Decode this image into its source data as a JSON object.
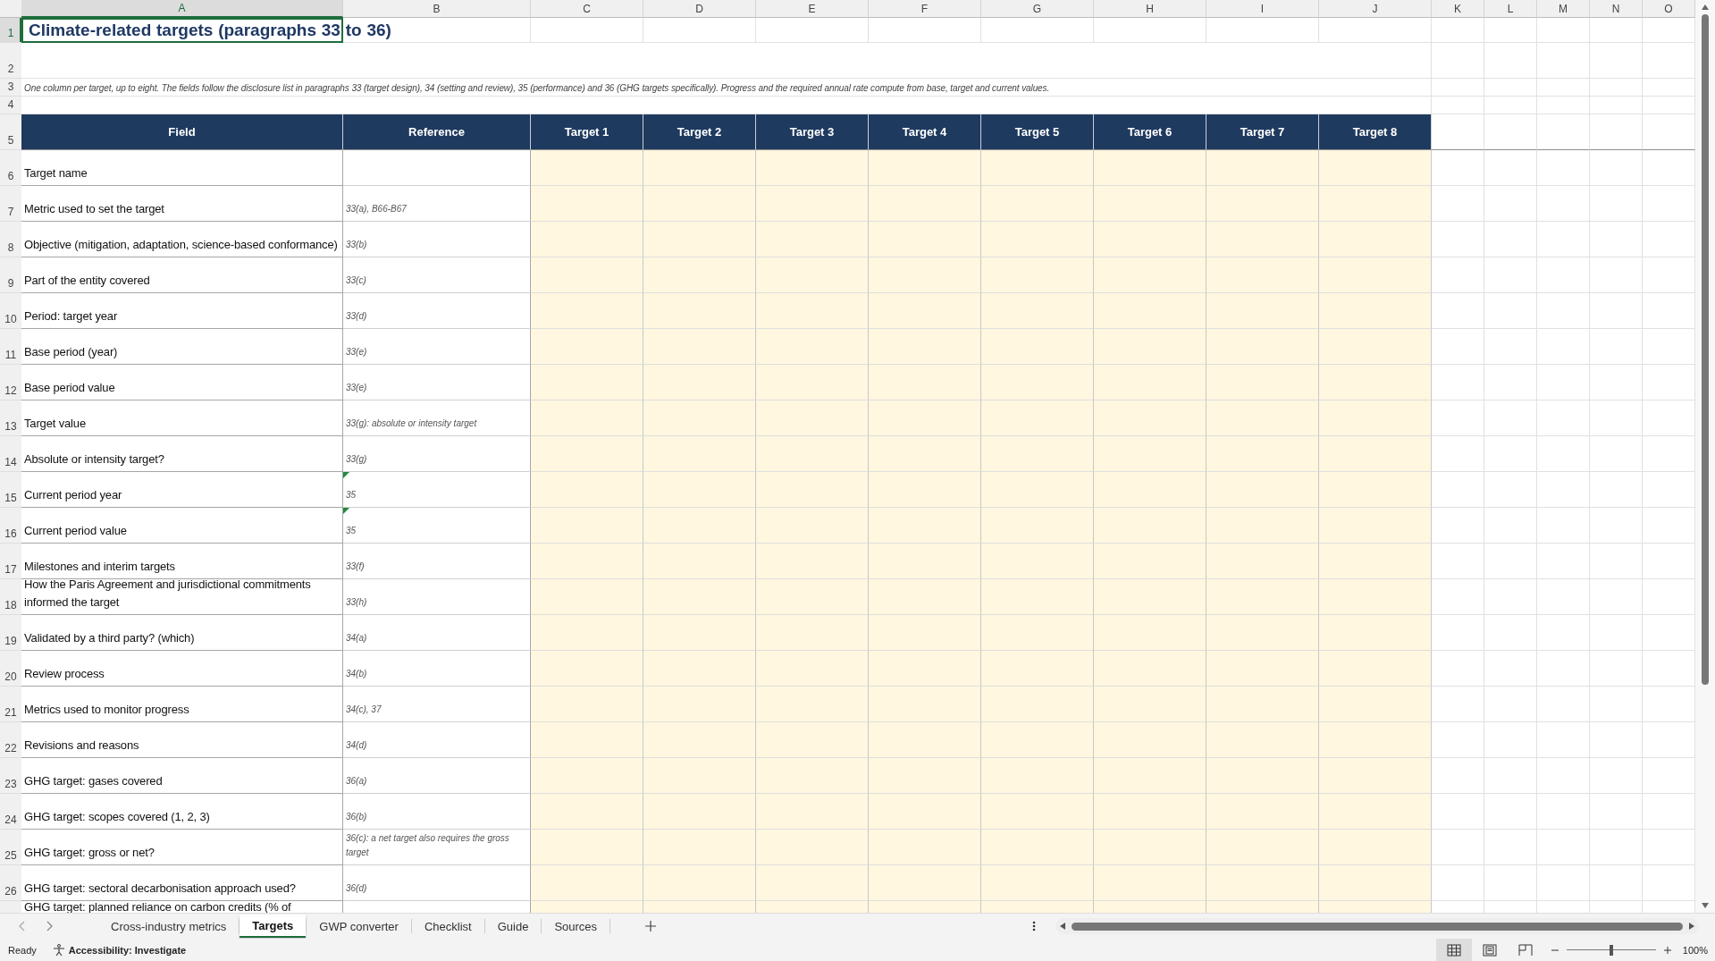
{
  "column_headers": [
    {
      "label": "A",
      "selected": true
    },
    {
      "label": "B",
      "selected": false
    },
    {
      "label": "C",
      "selected": false
    },
    {
      "label": "D",
      "selected": false
    },
    {
      "label": "E",
      "selected": false
    },
    {
      "label": "F",
      "selected": false
    },
    {
      "label": "G",
      "selected": false
    },
    {
      "label": "H",
      "selected": false
    },
    {
      "label": "I",
      "selected": false
    },
    {
      "label": "J",
      "selected": false
    },
    {
      "label": "K",
      "selected": false
    },
    {
      "label": "L",
      "selected": false
    },
    {
      "label": "M",
      "selected": false
    },
    {
      "label": "N",
      "selected": false
    },
    {
      "label": "O",
      "selected": false
    }
  ],
  "top_rows": [
    {
      "number": "1",
      "selected": true
    },
    {
      "number": "2",
      "selected": false
    },
    {
      "number": "3",
      "selected": false
    },
    {
      "number": "4",
      "selected": false
    },
    {
      "number": "5",
      "selected": false
    }
  ],
  "title": "Climate-related targets (paragraphs 33 to 36)",
  "note": "One column per target, up to eight. The fields follow the disclosure list in paragraphs 33 (target design), 34 (setting and review), 35 (performance) and 36 (GHG targets specifically). Progress and the required annual rate compute from base, target and current values.",
  "headers": [
    "Field",
    "Reference",
    "Target 1",
    "Target 2",
    "Target 3",
    "Target 4",
    "Target 5",
    "Target 6",
    "Target 7",
    "Target 8"
  ],
  "rows": [
    {
      "number": "6",
      "field": "Target name",
      "flagged": false
    },
    {
      "number": "7",
      "field": "Metric used to set the target",
      "reference": "33(a), B66-B67",
      "flagged": false
    },
    {
      "number": "8",
      "field": "Objective (mitigation, adaptation, science-based conformance)",
      "reference": "33(b)",
      "flagged": false
    },
    {
      "number": "9",
      "field": "Part of the entity covered",
      "reference": "33(c)",
      "flagged": false
    },
    {
      "number": "10",
      "field": "Period: target year",
      "reference": "33(d)",
      "flagged": false
    },
    {
      "number": "11",
      "field": "Base period (year)",
      "reference": "33(e)",
      "flagged": false
    },
    {
      "number": "12",
      "field": "Base period value",
      "reference": "33(e)",
      "flagged": false
    },
    {
      "number": "13",
      "field": "Target value",
      "reference": "33(g): absolute or intensity target",
      "flagged": false
    },
    {
      "number": "14",
      "field": "Absolute or intensity target?",
      "reference": "33(g)",
      "flagged": false
    },
    {
      "number": "15",
      "field": "Current period year",
      "reference": "35",
      "flagged": true
    },
    {
      "number": "16",
      "field": "Current period value",
      "reference": "35",
      "flagged": true
    },
    {
      "number": "17",
      "field": "Milestones and interim targets",
      "reference": "33(f)",
      "flagged": false
    },
    {
      "number": "18",
      "field": "How the Paris Agreement and jurisdictional commitments informed the target",
      "reference": "33(h)",
      "flagged": false
    },
    {
      "number": "19",
      "field": "Validated by a third party? (which)",
      "reference": "34(a)",
      "flagged": false
    },
    {
      "number": "20",
      "field": "Review process",
      "reference": "34(b)",
      "flagged": false
    },
    {
      "number": "21",
      "field": "Metrics used to monitor progress",
      "reference": "34(c), 37",
      "flagged": false
    },
    {
      "number": "22",
      "field": "Revisions and reasons",
      "reference": "34(d)",
      "flagged": false
    },
    {
      "number": "23",
      "field": "GHG target: gases covered",
      "reference": "36(a)",
      "flagged": false
    },
    {
      "number": "24",
      "field": "GHG target: scopes covered (1, 2, 3)",
      "reference": "36(b)",
      "flagged": false
    },
    {
      "number": "25",
      "field": "GHG target: gross or net?",
      "reference": "36(c): a net target also requires the gross target",
      "flagged": false
    },
    {
      "number": "26",
      "field": "GHG target: sectoral decarbonisation approach used?",
      "reference": "36(d)",
      "flagged": false
    },
    {
      "field": "GHG target: planned reliance on carbon credits (% of",
      "flagged": false
    }
  ],
  "sheet_tabs": [
    {
      "label": "Cross-industry metrics",
      "selected": false
    },
    {
      "label": "Targets",
      "selected": true
    },
    {
      "label": "GWP converter",
      "selected": false
    },
    {
      "label": "Checklist",
      "selected": false
    },
    {
      "label": "Guide",
      "selected": false
    },
    {
      "label": "Sources",
      "selected": false
    }
  ],
  "status_bar": {
    "state": "Ready",
    "accessibility": "Accessibility: Investigate",
    "zoom": "100%"
  },
  "view_modes": [
    {
      "kind": "normal",
      "selected": true
    },
    {
      "kind": "page-layout",
      "selected": false
    },
    {
      "kind": "page-break",
      "selected": false
    }
  ],
  "zoom_slider": {
    "level": 0.5
  }
}
